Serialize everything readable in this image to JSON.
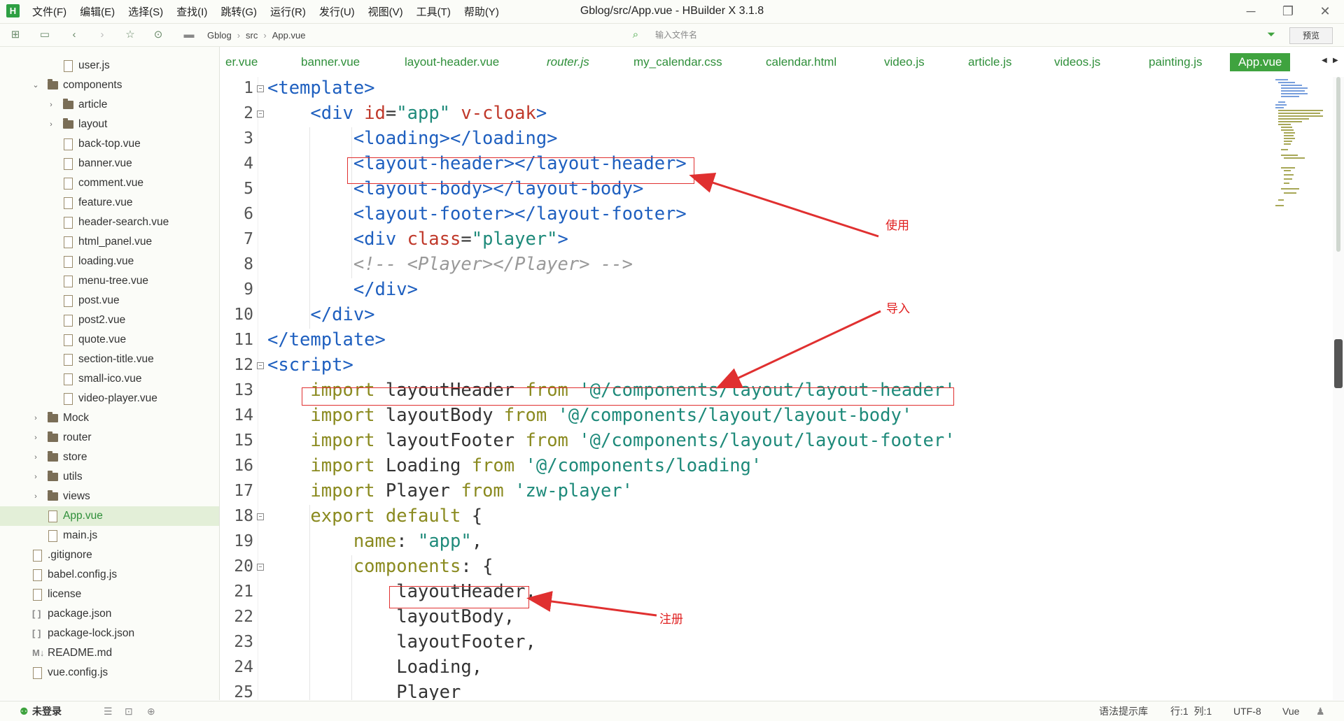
{
  "app": {
    "logo": "H",
    "title": "Gblog/src/App.vue - HBuilder X 3.1.8",
    "menu": [
      "文件(F)",
      "编辑(E)",
      "选择(S)",
      "查找(I)",
      "跳转(G)",
      "运行(R)",
      "发行(U)",
      "视图(V)",
      "工具(T)",
      "帮助(Y)"
    ],
    "window_controls": {
      "minimize": "─",
      "maximize": "❐",
      "close": "✕"
    }
  },
  "toolbar": {
    "breadcrumb": [
      "Gblog",
      "src",
      "App.vue"
    ],
    "file_search_placeholder": "输入文件名",
    "preview_label": "预览"
  },
  "sidebar": {
    "items": [
      {
        "label": "user.js",
        "type": "file",
        "depth": 2,
        "expanded": null,
        "selected": false
      },
      {
        "label": "components",
        "type": "folder",
        "depth": 1,
        "expanded": true,
        "selected": false
      },
      {
        "label": "article",
        "type": "folder",
        "depth": 2,
        "expanded": false,
        "selected": false
      },
      {
        "label": "layout",
        "type": "folder",
        "depth": 2,
        "expanded": false,
        "selected": false
      },
      {
        "label": "back-top.vue",
        "type": "file",
        "depth": 2,
        "expanded": null,
        "selected": false
      },
      {
        "label": "banner.vue",
        "type": "file",
        "depth": 2,
        "expanded": null,
        "selected": false
      },
      {
        "label": "comment.vue",
        "type": "file",
        "depth": 2,
        "expanded": null,
        "selected": false
      },
      {
        "label": "feature.vue",
        "type": "file",
        "depth": 2,
        "expanded": null,
        "selected": false
      },
      {
        "label": "header-search.vue",
        "type": "file",
        "depth": 2,
        "expanded": null,
        "selected": false
      },
      {
        "label": "html_panel.vue",
        "type": "file",
        "depth": 2,
        "expanded": null,
        "selected": false
      },
      {
        "label": "loading.vue",
        "type": "file",
        "depth": 2,
        "expanded": null,
        "selected": false
      },
      {
        "label": "menu-tree.vue",
        "type": "file",
        "depth": 2,
        "expanded": null,
        "selected": false
      },
      {
        "label": "post.vue",
        "type": "file",
        "depth": 2,
        "expanded": null,
        "selected": false
      },
      {
        "label": "post2.vue",
        "type": "file",
        "depth": 2,
        "expanded": null,
        "selected": false
      },
      {
        "label": "quote.vue",
        "type": "file",
        "depth": 2,
        "expanded": null,
        "selected": false
      },
      {
        "label": "section-title.vue",
        "type": "file",
        "depth": 2,
        "expanded": null,
        "selected": false
      },
      {
        "label": "small-ico.vue",
        "type": "file",
        "depth": 2,
        "expanded": null,
        "selected": false
      },
      {
        "label": "video-player.vue",
        "type": "file",
        "depth": 2,
        "expanded": null,
        "selected": false
      },
      {
        "label": "Mock",
        "type": "folder",
        "depth": 1,
        "expanded": false,
        "selected": false
      },
      {
        "label": "router",
        "type": "folder",
        "depth": 1,
        "expanded": false,
        "selected": false
      },
      {
        "label": "store",
        "type": "folder",
        "depth": 1,
        "expanded": false,
        "selected": false
      },
      {
        "label": "utils",
        "type": "folder",
        "depth": 1,
        "expanded": false,
        "selected": false
      },
      {
        "label": "views",
        "type": "folder",
        "depth": 1,
        "expanded": false,
        "selected": false
      },
      {
        "label": "App.vue",
        "type": "file",
        "depth": 1,
        "expanded": null,
        "selected": true
      },
      {
        "label": "main.js",
        "type": "file",
        "depth": 1,
        "expanded": null,
        "selected": false
      },
      {
        "label": ".gitignore",
        "type": "file",
        "depth": 0,
        "expanded": null,
        "selected": false
      },
      {
        "label": "babel.config.js",
        "type": "file",
        "depth": 0,
        "expanded": null,
        "selected": false
      },
      {
        "label": "license",
        "type": "file",
        "depth": 0,
        "expanded": null,
        "selected": false
      },
      {
        "label": "package.json",
        "type": "json",
        "depth": 0,
        "expanded": null,
        "selected": false
      },
      {
        "label": "package-lock.json",
        "type": "json",
        "depth": 0,
        "expanded": null,
        "selected": false
      },
      {
        "label": "README.md",
        "type": "md",
        "depth": 0,
        "expanded": null,
        "selected": false
      },
      {
        "label": "vue.config.js",
        "type": "file",
        "depth": 0,
        "expanded": null,
        "selected": false
      }
    ]
  },
  "tabs": [
    {
      "label": "er.vue",
      "italic": false,
      "active": false
    },
    {
      "label": "banner.vue",
      "italic": false,
      "active": false
    },
    {
      "label": "layout-header.vue",
      "italic": false,
      "active": false
    },
    {
      "label": "router.js",
      "italic": true,
      "active": false
    },
    {
      "label": "my_calendar.css",
      "italic": false,
      "active": false
    },
    {
      "label": "calendar.html",
      "italic": false,
      "active": false
    },
    {
      "label": "video.js",
      "italic": false,
      "active": false
    },
    {
      "label": "article.js",
      "italic": false,
      "active": false
    },
    {
      "label": "videos.js",
      "italic": false,
      "active": false
    },
    {
      "label": "painting.js",
      "italic": false,
      "active": false
    },
    {
      "label": "App.vue",
      "italic": false,
      "active": true
    }
  ],
  "editor": {
    "lines": [
      {
        "n": "1",
        "fold": true,
        "tokens": [
          [
            "tag",
            "<template>"
          ]
        ]
      },
      {
        "n": "2",
        "fold": true,
        "tokens": [
          [
            "plain",
            "    "
          ],
          [
            "tag",
            "<div "
          ],
          [
            "attr",
            "id"
          ],
          [
            "plain",
            "="
          ],
          [
            "str",
            "\"app\""
          ],
          [
            "plain",
            " "
          ],
          [
            "attr",
            "v-cloak"
          ],
          [
            "tag",
            ">"
          ]
        ]
      },
      {
        "n": "3",
        "fold": false,
        "tokens": [
          [
            "plain",
            "        "
          ],
          [
            "tag",
            "<loading></loading>"
          ]
        ]
      },
      {
        "n": "4",
        "fold": false,
        "tokens": [
          [
            "plain",
            "        "
          ],
          [
            "tag",
            "<layout-header></layout-header>"
          ]
        ]
      },
      {
        "n": "5",
        "fold": false,
        "tokens": [
          [
            "plain",
            "        "
          ],
          [
            "tag",
            "<layout-body></layout-body>"
          ]
        ]
      },
      {
        "n": "6",
        "fold": false,
        "tokens": [
          [
            "plain",
            "        "
          ],
          [
            "tag",
            "<layout-footer></layout-footer>"
          ]
        ]
      },
      {
        "n": "7",
        "fold": false,
        "tokens": [
          [
            "plain",
            "        "
          ],
          [
            "tag",
            "<div "
          ],
          [
            "attr",
            "class"
          ],
          [
            "plain",
            "="
          ],
          [
            "str",
            "\"player\""
          ],
          [
            "tag",
            ">"
          ]
        ]
      },
      {
        "n": "8",
        "fold": false,
        "tokens": [
          [
            "plain",
            "        "
          ],
          [
            "comment",
            "<!-- <Player></Player> -->"
          ]
        ]
      },
      {
        "n": "9",
        "fold": false,
        "tokens": [
          [
            "plain",
            "        "
          ],
          [
            "tag",
            "</div>"
          ]
        ]
      },
      {
        "n": "10",
        "fold": false,
        "tokens": [
          [
            "plain",
            "    "
          ],
          [
            "tag",
            "</div>"
          ]
        ]
      },
      {
        "n": "11",
        "fold": false,
        "tokens": [
          [
            "tag",
            "</template>"
          ]
        ]
      },
      {
        "n": "12",
        "fold": true,
        "tokens": [
          [
            "tag",
            "<script>"
          ]
        ]
      },
      {
        "n": "13",
        "fold": false,
        "tokens": [
          [
            "plain",
            "    "
          ],
          [
            "kw",
            "import"
          ],
          [
            "plain",
            " layoutHeader "
          ],
          [
            "kw",
            "from"
          ],
          [
            "plain",
            " "
          ],
          [
            "str",
            "'@/components/layout/layout-header'"
          ]
        ]
      },
      {
        "n": "14",
        "fold": false,
        "tokens": [
          [
            "plain",
            "    "
          ],
          [
            "kw",
            "import"
          ],
          [
            "plain",
            " layoutBody "
          ],
          [
            "kw",
            "from"
          ],
          [
            "plain",
            " "
          ],
          [
            "str",
            "'@/components/layout/layout-body'"
          ]
        ]
      },
      {
        "n": "15",
        "fold": false,
        "tokens": [
          [
            "plain",
            "    "
          ],
          [
            "kw",
            "import"
          ],
          [
            "plain",
            " layoutFooter "
          ],
          [
            "kw",
            "from"
          ],
          [
            "plain",
            " "
          ],
          [
            "str",
            "'@/components/layout/layout-footer'"
          ]
        ]
      },
      {
        "n": "16",
        "fold": false,
        "tokens": [
          [
            "plain",
            "    "
          ],
          [
            "kw",
            "import"
          ],
          [
            "plain",
            " Loading "
          ],
          [
            "kw",
            "from"
          ],
          [
            "plain",
            " "
          ],
          [
            "str",
            "'@/components/loading'"
          ]
        ]
      },
      {
        "n": "17",
        "fold": false,
        "tokens": [
          [
            "plain",
            "    "
          ],
          [
            "kw",
            "import"
          ],
          [
            "plain",
            " Player "
          ],
          [
            "kw",
            "from"
          ],
          [
            "plain",
            " "
          ],
          [
            "str",
            "'zw-player'"
          ]
        ]
      },
      {
        "n": "18",
        "fold": true,
        "tokens": [
          [
            "plain",
            "    "
          ],
          [
            "kw",
            "export"
          ],
          [
            "plain",
            " "
          ],
          [
            "kw",
            "default"
          ],
          [
            "plain",
            " {"
          ]
        ]
      },
      {
        "n": "19",
        "fold": false,
        "tokens": [
          [
            "plain",
            "        "
          ],
          [
            "prop",
            "name"
          ],
          [
            "plain",
            ": "
          ],
          [
            "str",
            "\"app\""
          ],
          [
            "plain",
            ","
          ]
        ]
      },
      {
        "n": "20",
        "fold": true,
        "tokens": [
          [
            "plain",
            "        "
          ],
          [
            "prop",
            "components"
          ],
          [
            "plain",
            ": {"
          ]
        ]
      },
      {
        "n": "21",
        "fold": false,
        "tokens": [
          [
            "plain",
            "            layoutHeader,"
          ]
        ]
      },
      {
        "n": "22",
        "fold": false,
        "tokens": [
          [
            "plain",
            "            layoutBody,"
          ]
        ]
      },
      {
        "n": "23",
        "fold": false,
        "tokens": [
          [
            "plain",
            "            layoutFooter,"
          ]
        ]
      },
      {
        "n": "24",
        "fold": false,
        "tokens": [
          [
            "plain",
            "            Loading,"
          ]
        ]
      },
      {
        "n": "25",
        "fold": false,
        "tokens": [
          [
            "plain",
            "            Player"
          ]
        ]
      }
    ]
  },
  "annotations": {
    "use": "使用",
    "import": "导入",
    "register": "注册"
  },
  "statusbar": {
    "login": "未登录",
    "syntax_lib": "语法提示库",
    "position": "行:1  列:1",
    "encoding": "UTF-8",
    "language": "Vue"
  },
  "colors": {
    "accent": "#3fa33f",
    "tag": "#1e5fbf",
    "attr": "#c0392b",
    "string": "#1e8a7a",
    "keyword": "#8a8a1f",
    "annotation": "#e03030"
  }
}
